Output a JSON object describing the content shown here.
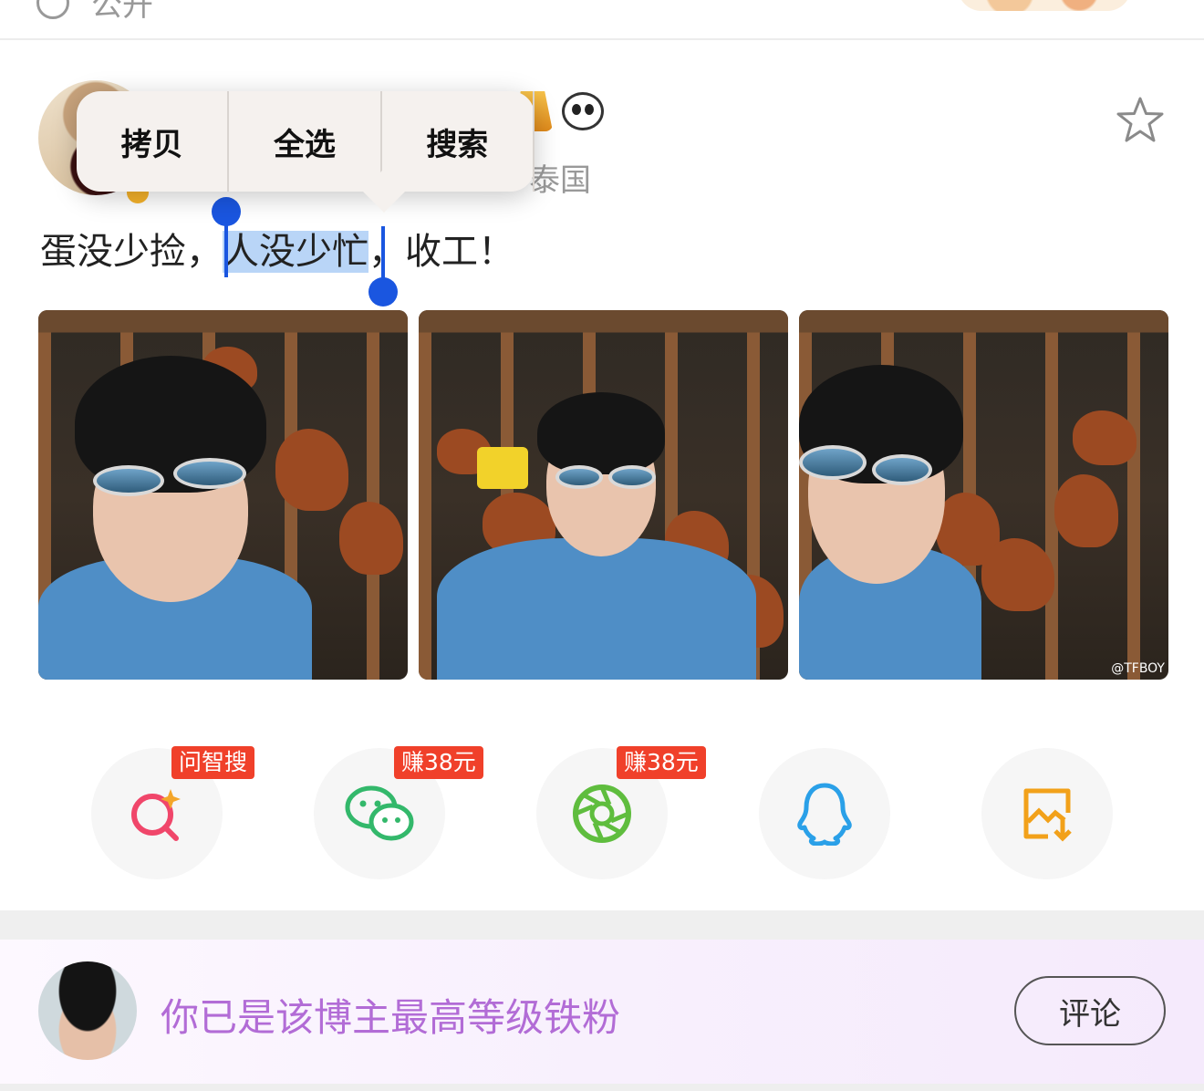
{
  "top": {
    "privacy_label": "公开"
  },
  "post": {
    "location": "泰国",
    "text_before": "蛋没少捡，",
    "text_selected": "人没少忙",
    "text_after": "，收工！",
    "watermark": "@TFBOY"
  },
  "context_menu": {
    "items": [
      "拷贝",
      "全选",
      "搜索"
    ]
  },
  "share": {
    "tags": [
      "问智搜",
      "赚38元",
      "赚38元"
    ],
    "colors": {
      "search": "#f0466a",
      "wechat": "#33b86b",
      "moments": "#5fbd3e",
      "qq": "#2aa0e8",
      "save": "#f2a11a"
    }
  },
  "bottom": {
    "fan_text": "你已是该博主最高等级铁粉",
    "comment_label": "评论"
  }
}
